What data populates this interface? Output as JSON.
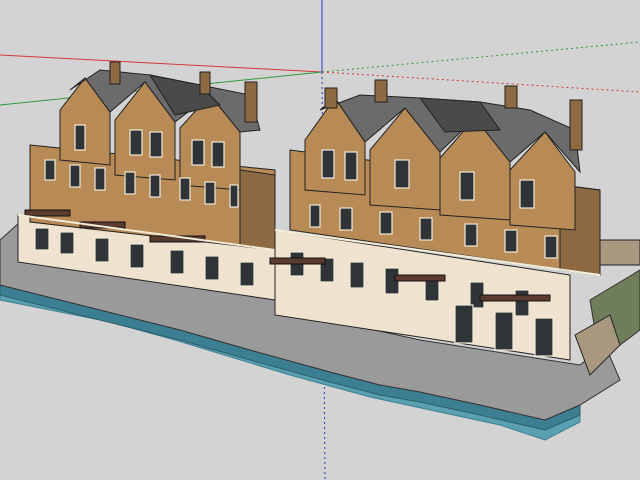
{
  "viewport": {
    "background_color": "#d3d3d3",
    "axes": {
      "red": "#d23a3a",
      "green": "#2e9a3a",
      "blue": "#2a3ad0"
    },
    "model": {
      "type": "3d-architectural-model",
      "subject": "townhouse-row",
      "blocks": 2,
      "colors": {
        "upper_wall": "#b88a55",
        "upper_wall_shade": "#8e6a42",
        "lower_wall": "#efe3cf",
        "roof": "#6b6b6b",
        "roof_dark": "#4a4a4a",
        "trim": "#f2ecd8",
        "window": "#2f3438",
        "ground": "#9a9a9a",
        "water": "#5aa0b0",
        "water_edge": "#3d7f92",
        "railing": "#5a3b2e",
        "stone": "#a89880"
      }
    }
  }
}
